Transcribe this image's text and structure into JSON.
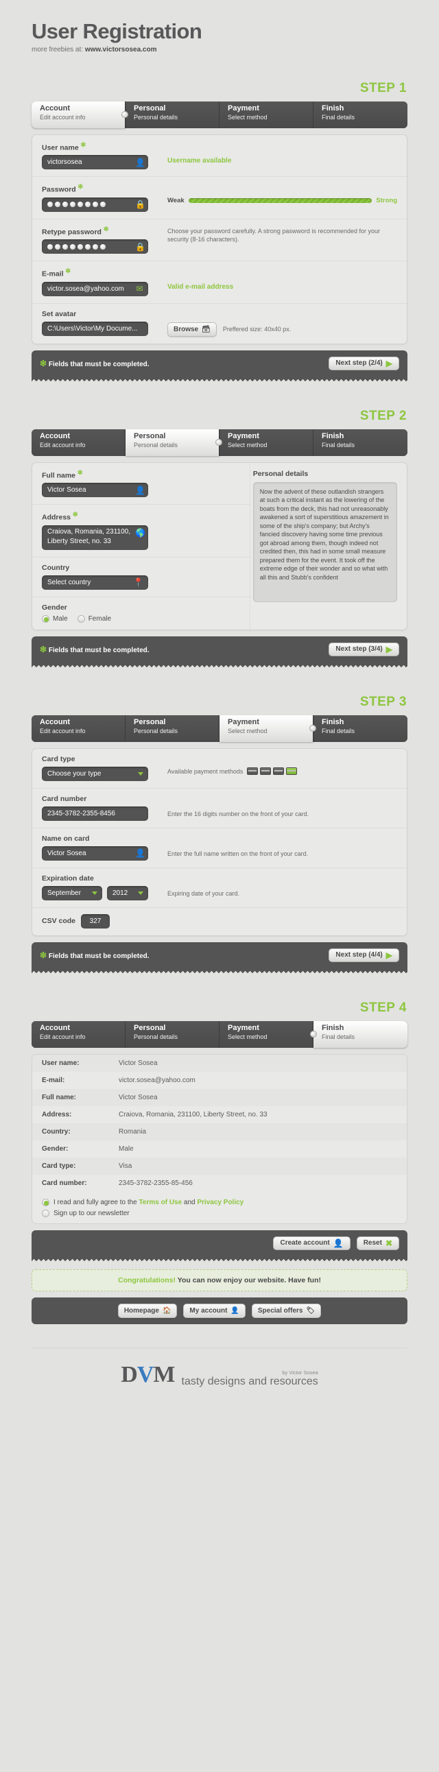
{
  "header": {
    "title": "User Registration",
    "subtitle_prefix": "more freebies at: ",
    "subtitle_site": "www.victorsosea.com"
  },
  "tabs": [
    {
      "main": "Account",
      "sub": "Edit account info"
    },
    {
      "main": "Personal",
      "sub": "Personal details"
    },
    {
      "main": "Payment",
      "sub": "Select method"
    },
    {
      "main": "Finish",
      "sub": "Final details"
    }
  ],
  "steps": {
    "s1": {
      "label": "STEP 1"
    },
    "s2": {
      "label": "STEP 2"
    },
    "s3": {
      "label": "STEP 3"
    },
    "s4": {
      "label": "STEP 4"
    }
  },
  "step1": {
    "username": {
      "label": "User name",
      "value": "victorsosea",
      "icon": "user-icon",
      "status": "Username available"
    },
    "password": {
      "label": "Password",
      "dots": 8,
      "icon": "lock-icon",
      "strength_low": "Weak",
      "strength_high": "Strong",
      "hint": "Choose your password carefully. A strong paswword is recommended for your security (8-16 characters)."
    },
    "retype": {
      "label": "Retype password",
      "dots": 8,
      "icon": "lock-icon"
    },
    "email": {
      "label": "E-mail",
      "value": "victor.sosea@yahoo.com",
      "icon": "envelope-icon",
      "status": "Valid e-mail address"
    },
    "avatar": {
      "label": "Set avatar",
      "value": "C:\\Users\\Victor\\My Docume...",
      "browse": "Browse",
      "browse_icon": "folder-icon",
      "hint": "Preffered size: 40x40 px."
    },
    "footer_note": "Fields that must be completed.",
    "next": "Next step (2/4)"
  },
  "step2": {
    "fullname": {
      "label": "Full name",
      "value": "Victor Sosea",
      "icon": "user-icon"
    },
    "address": {
      "label": "Address",
      "value": "Craiova, Romania, 231100, Liberty Street, no. 33",
      "icon": "globe-icon"
    },
    "country": {
      "label": "Country",
      "value": "Select country",
      "icon": "pin-icon"
    },
    "gender": {
      "label": "Gender",
      "options": [
        "Male",
        "Female"
      ],
      "selected": "Male"
    },
    "details_title": "Personal details",
    "details_text": "Now the advent of these outlandish strangers at such a critical instant as the lowering of the boats from the deck, this had not unreasonably awakened a sort of superstitious amazement in some of the ship's company; but Archy's fancied discovery having some time previous got abroad among them, though indeed not credited then, this had in some small measure prepared them for the event. It took off the extreme edge of their wonder and so what with all this and Stubb's confident",
    "footer_note": "Fields that must be completed.",
    "next": "Next step (3/4)"
  },
  "step3": {
    "cardtype": {
      "label": "Card type",
      "value": "Choose your type",
      "methods_label": "Available payment methods"
    },
    "cardnumber": {
      "label": "Card number",
      "value": "2345-3782-2355-8456",
      "hint": "Enter the 16 digits number on the front of your card."
    },
    "nameoncard": {
      "label": "Name on card",
      "value": "Victor Sosea",
      "icon": "user-icon",
      "hint": "Enter the full name written on the front of your card."
    },
    "expiration": {
      "label": "Expiration date",
      "month": "September",
      "year": "2012",
      "hint": "Expiring date of your card."
    },
    "csv": {
      "label": "CSV code",
      "value": "327"
    },
    "footer_note": "Fields that must be completed.",
    "next": "Next step (4/4)"
  },
  "step4": {
    "summary": [
      {
        "key": "User name:",
        "value": "Victor Sosea"
      },
      {
        "key": "E-mail:",
        "value": "victor.sosea@yahoo.com"
      },
      {
        "key": "Full name:",
        "value": "Victor Sosea"
      },
      {
        "key": "Address:",
        "value": "Craiova, Romania, 231100, Liberty Street, no. 33"
      },
      {
        "key": "Country:",
        "value": "Romania"
      },
      {
        "key": "Gender:",
        "value": "Male"
      },
      {
        "key": "Card type:",
        "value": "Visa"
      },
      {
        "key": "Card number:",
        "value": "2345-3782-2355-85-456"
      }
    ],
    "agree_pre": "I read and fully agree to the ",
    "agree_terms": "Terms of Use",
    "agree_and": " and ",
    "agree_privacy": "Privacy Policy",
    "newsletter": "Sign up to our newsletter",
    "create": "Create account",
    "create_icon": "user-icon",
    "reset": "Reset",
    "reset_icon": "close-icon"
  },
  "done": {
    "congrats_em": "Congratulations!",
    "congrats_rest": " You can now enjoy our website. Have fun!",
    "links": [
      {
        "label": "Homepage",
        "icon": "home-icon"
      },
      {
        "label": "My account",
        "icon": "user-icon"
      },
      {
        "label": "Special offers",
        "icon": "tag-icon"
      }
    ]
  },
  "footer": {
    "logo_d": "D",
    "logo_v": "V",
    "logo_m": "M",
    "tagline": "tasty designs and resources",
    "by": "by Victor Sosea"
  }
}
